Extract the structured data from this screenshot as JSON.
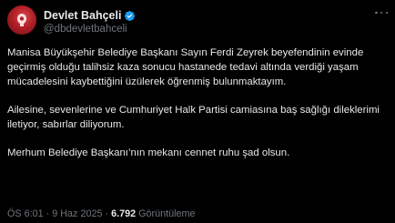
{
  "author": {
    "display_name": "Devlet Bahçeli",
    "handle": "@dbdevletbahceli"
  },
  "icons": {
    "avatar": "profile-photo",
    "verified": "verified-badge-icon",
    "more": "more-options-icon"
  },
  "colors": {
    "background": "#000000",
    "text": "#e7e9ea",
    "muted": "#71767b",
    "verified_badge": "#1d9bf0"
  },
  "tweet": {
    "paragraphs": [
      "Manisa Büyükşehir Belediye Başkanı Sayın Ferdi Zeyrek beyefendinin evinde geçirmiş olduğu talihsiz kaza sonucu hastanede tedavi altında verdiği yaşam mücadelesini kaybettiğini üzülerek öğrenmiş bulunmaktayım.",
      "Ailesine, sevenlerine ve Cumhuriyet Halk Partisi camiasına baş sağlığı dileklerimi iletiyor, sabırlar diliyorum.",
      "Merhum Belediye Başkanı’nın mekanı cennet ruhu şad olsun."
    ]
  },
  "meta": {
    "time": "ÖS 6:01",
    "separator": "·",
    "date": "9 Haz 2025",
    "views_count": "6.792",
    "views_label": "Görüntüleme"
  }
}
